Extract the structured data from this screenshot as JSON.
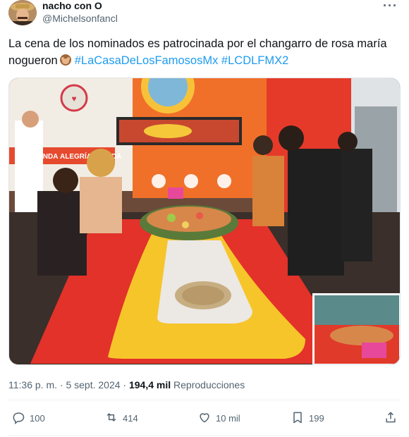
{
  "author": {
    "display_name": "nacho con O",
    "handle": "@Michelsonfancl"
  },
  "tweet": {
    "text_parts": [
      "La cena de los nominados es patrocinada por el changarro de rosa maría nogueron",
      "#LaCasaDeLosFamososMx",
      "#LCDLFMX2"
    ],
    "emoji": "see-no-evil-monkey-icon"
  },
  "media": {
    "sign_text": "ALEGRÍA TU VIDA",
    "sign_text_left": "ONDA"
  },
  "meta": {
    "time": "11:36 p. m.",
    "separator1": "·",
    "date": "5 sept. 2024",
    "separator2": "·",
    "views_count": "194,4 mil",
    "views_label": "Reproducciones"
  },
  "actions": {
    "replies": "100",
    "reposts": "414",
    "likes": "10 mil",
    "bookmarks": "199"
  },
  "icons": [
    "more-icon",
    "reply-icon",
    "repost-icon",
    "like-icon",
    "bookmark-icon",
    "share-icon"
  ],
  "colors": {
    "text": "#0f1419",
    "secondary": "#536471",
    "link": "#1d9bf0"
  }
}
